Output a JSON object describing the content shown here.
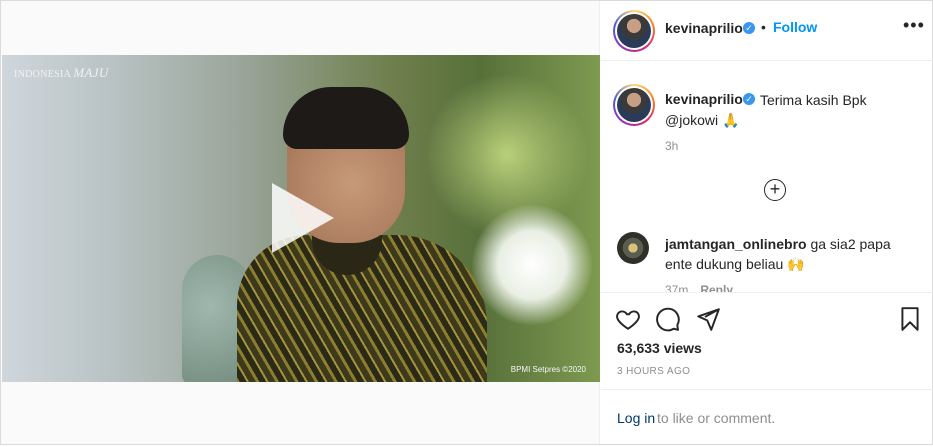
{
  "video": {
    "watermark_logo_a": "INDONESIA",
    "watermark_logo_b": "MAJU",
    "watermark_copyright": "BPMI Setpres ©2020"
  },
  "header": {
    "username": "kevinaprilio",
    "separator": "•",
    "follow_label": "Follow",
    "more_label": "•••"
  },
  "caption": {
    "username": "kevinaprilio",
    "text": "Terima kasih Bpk @jokowi 🙏",
    "time": "3h"
  },
  "load_more_label": "+",
  "comment": {
    "username": "jamtangan_onlinebro",
    "text": " ga sia2 papa ente dukung beliau 🙌",
    "time": "37m",
    "reply_label": "Reply"
  },
  "stats": {
    "views": "63,633 views",
    "ago": "3 HOURS AGO"
  },
  "login": {
    "link": "Log in",
    "rest": "to like or comment."
  },
  "colors": {
    "accent": "#0095f6",
    "verified": "#3897f0"
  },
  "icons": [
    "heart-icon",
    "comment-icon",
    "share-icon",
    "bookmark-icon",
    "play-icon",
    "verified-badge-icon",
    "plus-circle-icon"
  ]
}
